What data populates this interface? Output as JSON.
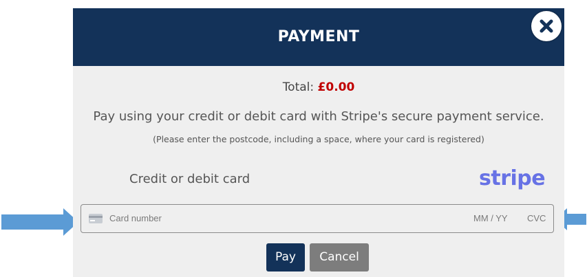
{
  "modal": {
    "title": "PAYMENT",
    "close_icon": "close-icon",
    "total_label": "Total:",
    "total_amount": "£0.00",
    "info": "Pay using your credit or debit card with Stripe's secure payment service.",
    "subinfo": "(Please enter the postcode, including a space, where your card is registered)",
    "card_label": "Credit or debit card",
    "stripe_logo": "stripe",
    "card_field": {
      "icon": "credit-card-icon",
      "number_placeholder": "Card number",
      "expiry_placeholder": "MM / YY",
      "cvc_placeholder": "CVC"
    },
    "pay_label": "Pay",
    "cancel_label": "Cancel"
  },
  "annotations": {
    "arrow_icon": "arrow-icon",
    "arrow_color": "#5b9bd5"
  },
  "colors": {
    "header": "#133259",
    "body": "#efefef",
    "amount": "#c00000",
    "stripe": "#6772e5",
    "cancel": "#7d7d7d"
  }
}
